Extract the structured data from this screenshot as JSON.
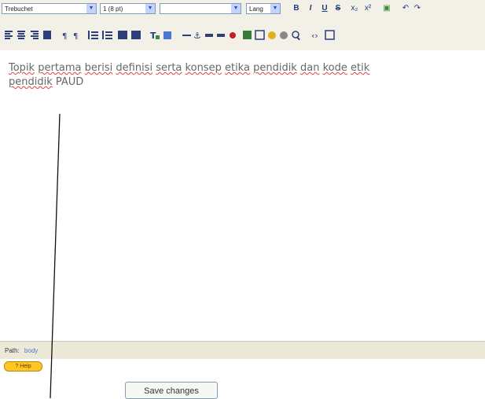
{
  "toolbar1": {
    "font_family": "Trebuchet",
    "font_size": "1 (8 pt)",
    "style": "",
    "language": "Lang",
    "bold": "B",
    "italic": "I",
    "underline": "U",
    "strike": "S",
    "subscript": "x₂",
    "superscript": "x²",
    "clean": "▣",
    "undo": "↶",
    "redo": "↷"
  },
  "toolbar2": {
    "icons": [
      "align-left-icon",
      "align-center-icon",
      "align-right-icon",
      "justify-icon",
      "ltr-icon",
      "rtl-icon",
      "ordered-list-icon",
      "unordered-list-icon",
      "outdent-icon",
      "indent-icon",
      "text-color-icon",
      "background-color-icon",
      "horizontal-rule-icon",
      "anchor-icon",
      "link-icon",
      "unlink-icon",
      "no-link-icon",
      "image-icon",
      "table-icon",
      "smiley-icon",
      "special-char-icon",
      "search-icon",
      "code-icon",
      "fullscreen-icon"
    ]
  },
  "editor": {
    "line1": [
      "Topik",
      "pertama",
      "berisi",
      "definisi",
      "serta",
      "konsep",
      "etika",
      "pendidik",
      "dan",
      "kode",
      "etik"
    ],
    "line2_word": "pendidik",
    "line2_rest": "PAUD"
  },
  "pathbar": {
    "label": "Path:",
    "value": "body"
  },
  "help_badge": "? Help",
  "save_button": "Save changes"
}
